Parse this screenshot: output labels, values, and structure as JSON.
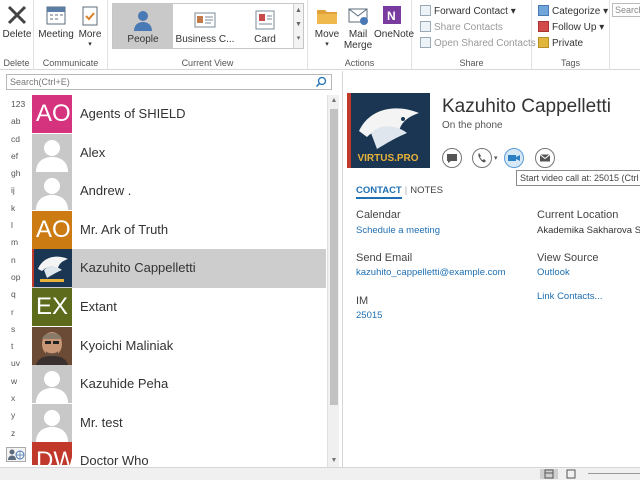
{
  "ribbon": {
    "delete_group": {
      "delete_label": "Delete",
      "group_label": "Delete"
    },
    "communicate_group": {
      "meeting_label": "Meeting",
      "more_label": "More",
      "group_label": "Communicate"
    },
    "current_view": {
      "items": [
        {
          "label": "People",
          "selected": true
        },
        {
          "label": "Business C...",
          "selected": false
        },
        {
          "label": "Card",
          "selected": false
        }
      ],
      "group_label": "Current View"
    },
    "actions_group": {
      "move_label": "Move",
      "mail_merge_label": "Mail Merge",
      "onenote_label": "OneNote",
      "group_label": "Actions"
    },
    "share_group": {
      "forward_contact_label": "Forward Contact",
      "share_contacts_label": "Share Contacts",
      "open_shared_label": "Open Shared Contacts",
      "group_label": "Share"
    },
    "tags_group": {
      "categorize_label": "Categorize",
      "follow_up_label": "Follow Up",
      "private_label": "Private",
      "group_label": "Tags"
    },
    "search_label": "Search"
  },
  "search": {
    "placeholder": "Search(Ctrl+E)"
  },
  "alphabet": [
    "123",
    "ab",
    "cd",
    "ef",
    "gh",
    "ij",
    "k",
    "l",
    "m",
    "n",
    "op",
    "q",
    "r",
    "s",
    "t",
    "uv",
    "w",
    "x",
    "y",
    "z"
  ],
  "contacts": [
    {
      "name": "Agents of SHIELD",
      "initials": "AO",
      "color": "#d6337f",
      "type": "initials",
      "selected": false
    },
    {
      "name": "Alex",
      "initials": "",
      "color": "#c8c8c8",
      "type": "silhouette",
      "selected": false
    },
    {
      "name": "Andrew .",
      "initials": "",
      "color": "#c8c8c8",
      "type": "silhouette",
      "selected": false
    },
    {
      "name": "Mr. Ark of Truth",
      "initials": "AO",
      "color": "#cc7a12",
      "type": "initials",
      "selected": false
    },
    {
      "name": "Kazuhito Cappelletti",
      "initials": "",
      "color": "#1b3652",
      "type": "photo-logo",
      "selected": true
    },
    {
      "name": "Extant",
      "initials": "EX",
      "color": "#5c6b1c",
      "type": "initials",
      "selected": false
    },
    {
      "name": "Kyoichi Maliniak",
      "initials": "",
      "color": "#8a5a3c",
      "type": "photo-person",
      "selected": false
    },
    {
      "name": "Kazuhide Peha",
      "initials": "",
      "color": "#c8c8c8",
      "type": "silhouette",
      "selected": false
    },
    {
      "name": "Mr. test",
      "initials": "",
      "color": "#c8c8c8",
      "type": "silhouette",
      "selected": false
    },
    {
      "name": "Doctor Who",
      "initials": "DW",
      "color": "#c0392b",
      "type": "initials",
      "selected": false
    }
  ],
  "detail": {
    "name": "Kazuhito Cappelletti",
    "status": "On the phone",
    "logo_text": "VIRTUS.PRO",
    "tooltip": "Start video call at: 25015 (Ctrl",
    "tabs": {
      "contact": "CONTACT",
      "notes": "NOTES"
    },
    "calendar": {
      "label": "Calendar",
      "value": "Schedule a meeting"
    },
    "email": {
      "label": "Send Email",
      "value": "kazuhito_cappelletti@example.com"
    },
    "im": {
      "label": "IM",
      "value": "25015"
    },
    "location": {
      "label": "Current Location",
      "value": "Akademika Sakharova Str"
    },
    "view_source": {
      "label": "View Source",
      "value": "Outlook"
    },
    "link_contacts": "Link Contacts..."
  },
  "colors": {
    "accent": "#1f6fb2",
    "selection": "#cdcdcd",
    "status_busy": "#c0392b"
  }
}
